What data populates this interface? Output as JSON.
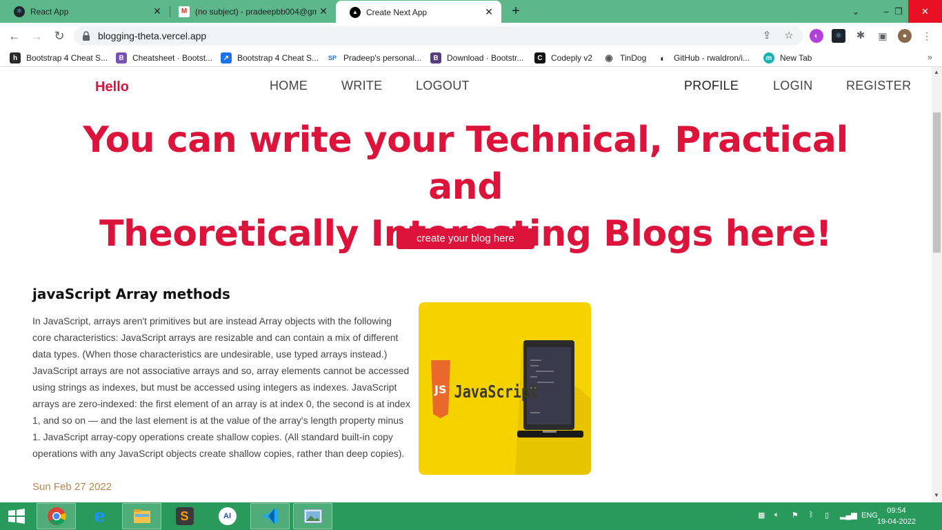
{
  "browser": {
    "tabs": [
      {
        "title": "React App",
        "icon": "react-icon",
        "active": false
      },
      {
        "title": "(no subject) - pradeepbb004@gm",
        "icon": "gmail-icon",
        "active": false
      },
      {
        "title": "Create Next App",
        "icon": "vercel-icon",
        "active": true
      }
    ],
    "new_tab_label": "+",
    "url": "blogging-theta.vercel.app",
    "bookmarks": [
      {
        "label": "Bootstrap 4 Cheat S...",
        "icon": "h",
        "color": "#2b2b2b"
      },
      {
        "label": "Cheatsheet · Bootst...",
        "icon": "B",
        "color": "#7952b3"
      },
      {
        "label": "Bootstrap 4 Cheat S...",
        "icon": "↗",
        "color": "#1a73e8"
      },
      {
        "label": "Pradeep's personal...",
        "icon": "SP",
        "color": "#1a73e8"
      },
      {
        "label": "Download · Bootstr...",
        "icon": "B",
        "color": "#563d7c"
      },
      {
        "label": "Codeply v2",
        "icon": "C",
        "color": "#111111"
      },
      {
        "label": "TinDog",
        "icon": "◉",
        "color": "#555555"
      },
      {
        "label": "GitHub - rwaldron/i...",
        "icon": "◐",
        "color": "#222222"
      },
      {
        "label": "New Tab",
        "icon": "m",
        "color": "#17b3b3"
      }
    ],
    "more_bookmarks": "»"
  },
  "site": {
    "brand": "Hello",
    "nav_left": [
      "HOME",
      "WRITE",
      "LOGOUT"
    ],
    "nav_right": [
      "PROFILE",
      "LOGIN",
      "REGISTER"
    ],
    "hero_line1": "You can write your Technical, Practical and",
    "hero_line2": "Theoretically Interesting Blogs here!",
    "cta_label": "create your blog here",
    "post": {
      "title": "javaScript Array methods",
      "body": "In JavaScript, arrays aren't primitives but are instead Array objects with the following core characteristics: JavaScript arrays are resizable and can contain a mix of different data types. (When those characteristics are undesirable, use typed arrays instead.) JavaScript arrays are not associative arrays and so, array elements cannot be accessed using strings as indexes, but must be accessed using integers as indexes. JavaScript arrays are zero-indexed: the first element of an array is at index 0, the second is at index 1, and so on — and the last element is at the value of the array's length property minus 1. JavaScript array-copy operations create shallow copies. (All standard built-in copy operations with any JavaScript objects create shallow copies, rather than deep copies).",
      "image_caption": "JavaScript",
      "image_badge": "JS",
      "date": "Sun Feb 27 2022"
    }
  },
  "taskbar": {
    "language": "ENG",
    "time": "09:54",
    "date": "19-04-2022"
  },
  "colors": {
    "accent": "#dc143c",
    "tab_strip": "#5cb88a",
    "taskbar": "#2a9a5c",
    "date_text": "#b8864e"
  }
}
